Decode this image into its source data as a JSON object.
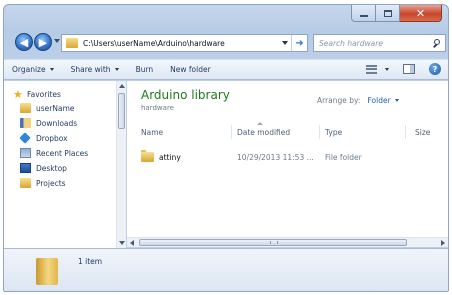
{
  "address": {
    "path": "C:\\Users\\userName\\Arduino\\hardware",
    "search_placeholder": "Search hardware"
  },
  "toolbar": {
    "organize": "Organize",
    "share_with": "Share with",
    "burn": "Burn",
    "new_folder": "New folder"
  },
  "sidebar": {
    "favorites_label": "Favorites",
    "items": [
      {
        "label": "userName",
        "icon": "folder-icon"
      },
      {
        "label": "Downloads",
        "icon": "downloads-icon"
      },
      {
        "label": "Dropbox",
        "icon": "dropbox-icon"
      },
      {
        "label": "Recent Places",
        "icon": "recent-places-icon"
      },
      {
        "label": "Desktop",
        "icon": "desktop-icon"
      },
      {
        "label": "Projects",
        "icon": "folder-icon"
      }
    ]
  },
  "library": {
    "title": "Arduino library",
    "subtitle": "hardware",
    "arrange_label": "Arrange by:",
    "arrange_value": "Folder"
  },
  "columns": {
    "name": "Name",
    "date": "Date modified",
    "type": "Type",
    "size": "Size"
  },
  "files": [
    {
      "name": "attiny",
      "date": "10/29/2013 11:53 ...",
      "type": "File folder",
      "size": ""
    }
  ],
  "details": {
    "count": "1 item"
  }
}
